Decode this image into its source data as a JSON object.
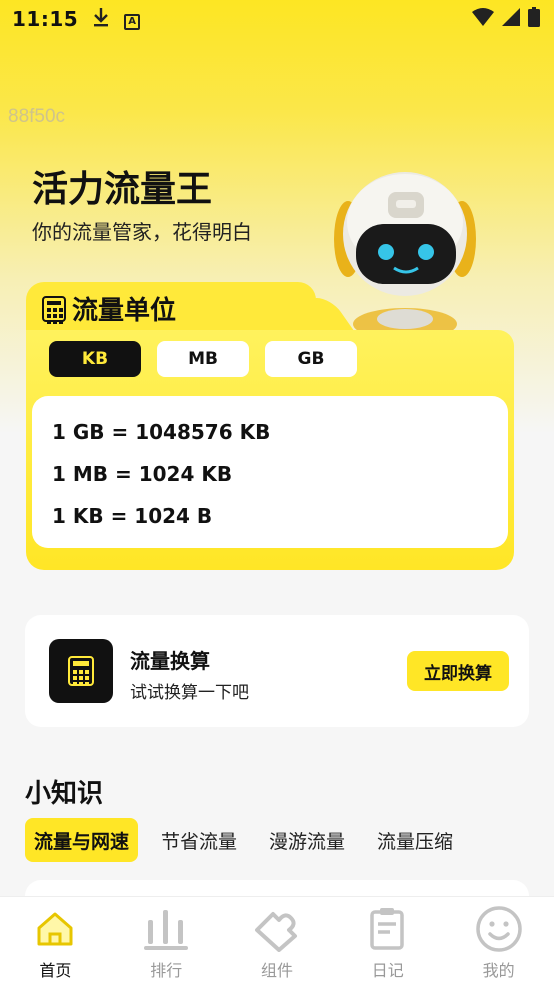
{
  "status_bar": {
    "time": "11:15",
    "icons": [
      "download-icon",
      "a-notification-icon",
      "wifi-icon",
      "signal-icon",
      "battery-icon"
    ]
  },
  "debug_code": "88f50c",
  "hero": {
    "title": "活力流量王",
    "subtitle": "你的流量管家，花得明白",
    "mascot": "robot-mascot"
  },
  "units_card": {
    "title": "流量单位",
    "tabs": [
      {
        "label": "KB",
        "active": true
      },
      {
        "label": "MB",
        "active": false
      },
      {
        "label": "GB",
        "active": false
      }
    ],
    "conversions": [
      "1 GB = 1048576 KB",
      "1 MB = 1024 KB",
      "1 KB = 1024 B"
    ]
  },
  "converter_card": {
    "title": "流量换算",
    "subtitle": "试试换算一下吧",
    "button": "立即换算"
  },
  "tips": {
    "title": "小知识",
    "tabs": [
      {
        "label": "流量与网速",
        "active": true
      },
      {
        "label": "节省流量",
        "active": false
      },
      {
        "label": "漫游流量",
        "active": false
      },
      {
        "label": "流量压缩",
        "active": false
      }
    ]
  },
  "bottom_nav": {
    "items": [
      {
        "label": "首页",
        "icon": "home-icon",
        "active": true
      },
      {
        "label": "排行",
        "icon": "bar-chart-icon",
        "active": false
      },
      {
        "label": "组件",
        "icon": "puzzle-icon",
        "active": false
      },
      {
        "label": "日记",
        "icon": "notepad-icon",
        "active": false
      },
      {
        "label": "我的",
        "icon": "smiley-icon",
        "active": false
      }
    ]
  },
  "colors": {
    "accent": "#ffe626",
    "dark": "#111111",
    "inactive_nav": "#999999"
  }
}
